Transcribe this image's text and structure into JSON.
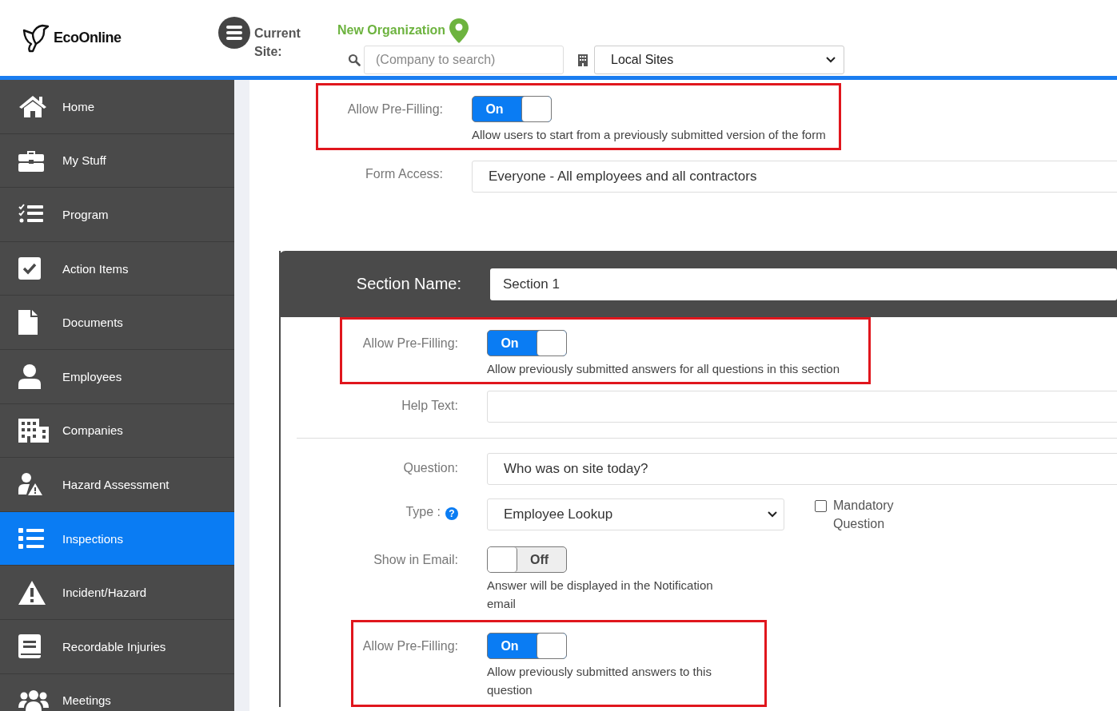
{
  "header": {
    "logo": "EcoOnline",
    "current_site_label": "Current Site:",
    "organization": "New Organization",
    "search": {
      "placeholder": "(Company to search)"
    },
    "site_select": {
      "value": "Local Sites"
    }
  },
  "sidebar": {
    "items": [
      {
        "label": "Home",
        "selected": false
      },
      {
        "label": "My Stuff",
        "selected": false
      },
      {
        "label": "Program",
        "selected": false
      },
      {
        "label": "Action Items",
        "selected": false
      },
      {
        "label": "Documents",
        "selected": false
      },
      {
        "label": "Employees",
        "selected": false
      },
      {
        "label": "Companies",
        "selected": false
      },
      {
        "label": "Hazard Assessment",
        "selected": false
      },
      {
        "label": "Inspections",
        "selected": true
      },
      {
        "label": "Incident/Hazard",
        "selected": false
      },
      {
        "label": "Recordable Injuries",
        "selected": false
      },
      {
        "label": "Meetings",
        "selected": false
      }
    ]
  },
  "form_settings": [
    {
      "kind": "toggle",
      "label": "Allow Pre-Filling:",
      "on": true,
      "toggle_text": "On",
      "description": "Allow users to start from a previously submitted version of the form",
      "highlighted": true
    },
    {
      "kind": "select",
      "label": "Form Access:",
      "value": "Everyone - All employees and all contractors",
      "highlighted": false
    }
  ],
  "section": {
    "name_label": "Section Name:",
    "name_value": "Section 1",
    "section_fields": [
      {
        "kind": "toggle",
        "label": "Allow Pre-Filling:",
        "on": true,
        "toggle_text": "On",
        "description": "Allow previously submitted answers for all questions in this section",
        "highlighted": true
      },
      {
        "kind": "text",
        "label": "Help Text:",
        "highlighted": false
      }
    ],
    "question_fields": [
      {
        "kind": "text",
        "label": "Question:",
        "value": "Who was on site today?",
        "highlighted": false
      },
      {
        "kind": "dropdown",
        "label": "Type :",
        "help_icon": "?",
        "value": "Employee Lookup",
        "checkbox_label": "Mandatory Question",
        "checked": false,
        "highlighted": false
      },
      {
        "kind": "toggle",
        "label": "Show in Email:",
        "on": false,
        "toggle_text": "Off",
        "description": "Answer will be displayed in the Notification email",
        "highlighted": false
      },
      {
        "kind": "toggle",
        "label": "Allow Pre-Filling:",
        "on": true,
        "toggle_text": "On",
        "description": "Allow previously submitted answers to this question",
        "highlighted": true
      }
    ]
  }
}
